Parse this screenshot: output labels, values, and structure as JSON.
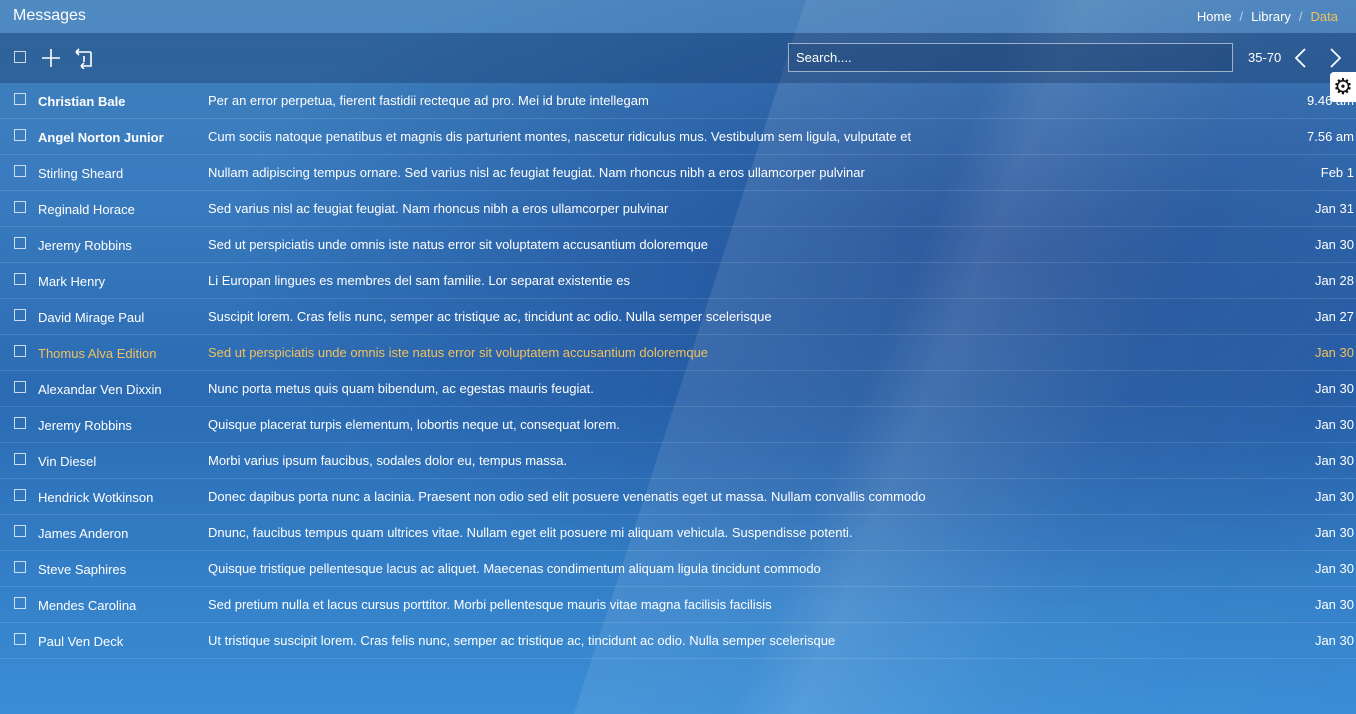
{
  "header": {
    "title": "Messages",
    "breadcrumb": [
      "Home",
      "Library",
      "Data"
    ]
  },
  "toolbar": {
    "search_placeholder": "Search....",
    "range": "35-70"
  },
  "icons": {
    "add": "plus-icon",
    "reply": "reply-icon",
    "prev": "chevron-left-icon",
    "next": "chevron-right-icon",
    "settings": "gear-icon"
  },
  "colors": {
    "highlight": "#f0c060"
  },
  "messages": [
    {
      "sender": "Christian Bale",
      "subject": "Per an error perpetua, fierent fastidii recteque ad pro. Mei id brute intellegam",
      "date": "9.46 am",
      "unread": true
    },
    {
      "sender": "Angel Norton Junior",
      "subject": "Cum sociis natoque penatibus et magnis dis parturient montes, nascetur ridiculus mus. Vestibulum sem ligula, vulputate et",
      "date": "7.56 am",
      "unread": true
    },
    {
      "sender": "Stirling Sheard",
      "subject": "Nullam adipiscing tempus ornare. Sed varius nisl ac feugiat feugiat. Nam rhoncus nibh a eros ullamcorper pulvinar",
      "date": "Feb 1"
    },
    {
      "sender": "Reginald Horace",
      "subject": "Sed varius nisl ac feugiat feugiat. Nam rhoncus nibh a eros ullamcorper pulvinar",
      "date": "Jan 31"
    },
    {
      "sender": "Jeremy Robbins",
      "subject": "Sed ut perspiciatis unde omnis iste natus error sit voluptatem accusantium doloremque",
      "date": "Jan 30"
    },
    {
      "sender": "Mark Henry",
      "subject": "Li Europan lingues es membres del sam familie. Lor separat existentie es",
      "date": "Jan 28"
    },
    {
      "sender": "David Mirage Paul",
      "subject": "Suscipit lorem. Cras felis nunc, semper ac tristique ac, tincidunt ac odio. Nulla semper scelerisque",
      "date": "Jan 27"
    },
    {
      "sender": "Thomus Alva Edition",
      "subject": "Sed ut perspiciatis unde omnis iste natus error sit voluptatem accusantium doloremque",
      "date": "Jan 30",
      "highlight": true
    },
    {
      "sender": "Alexandar Ven Dixxin",
      "subject": "Nunc porta metus quis quam bibendum, ac egestas mauris feugiat.",
      "date": "Jan 30"
    },
    {
      "sender": "Jeremy Robbins",
      "subject": "Quisque placerat turpis elementum, lobortis neque ut, consequat lorem.",
      "date": "Jan 30"
    },
    {
      "sender": "Vin Diesel",
      "subject": "Morbi varius ipsum faucibus, sodales dolor eu, tempus massa.",
      "date": "Jan 30"
    },
    {
      "sender": "Hendrick Wotkinson",
      "subject": "Donec dapibus porta nunc a lacinia. Praesent non odio sed elit posuere venenatis eget ut massa. Nullam convallis commodo",
      "date": "Jan 30"
    },
    {
      "sender": "James Anderon",
      "subject": "Dnunc, faucibus tempus quam ultrices vitae. Nullam eget elit posuere mi aliquam vehicula. Suspendisse potenti.",
      "date": "Jan 30"
    },
    {
      "sender": "Steve Saphires",
      "subject": "Quisque tristique pellentesque lacus ac aliquet. Maecenas condimentum aliquam ligula tincidunt commodo",
      "date": "Jan 30"
    },
    {
      "sender": "Mendes Carolina",
      "subject": "Sed pretium nulla et lacus cursus porttitor. Morbi pellentesque mauris vitae magna facilisis facilisis",
      "date": "Jan 30"
    },
    {
      "sender": "Paul Ven Deck",
      "subject": "Ut tristique suscipit lorem. Cras felis nunc, semper ac tristique ac, tincidunt ac odio. Nulla semper scelerisque",
      "date": "Jan 30"
    }
  ]
}
